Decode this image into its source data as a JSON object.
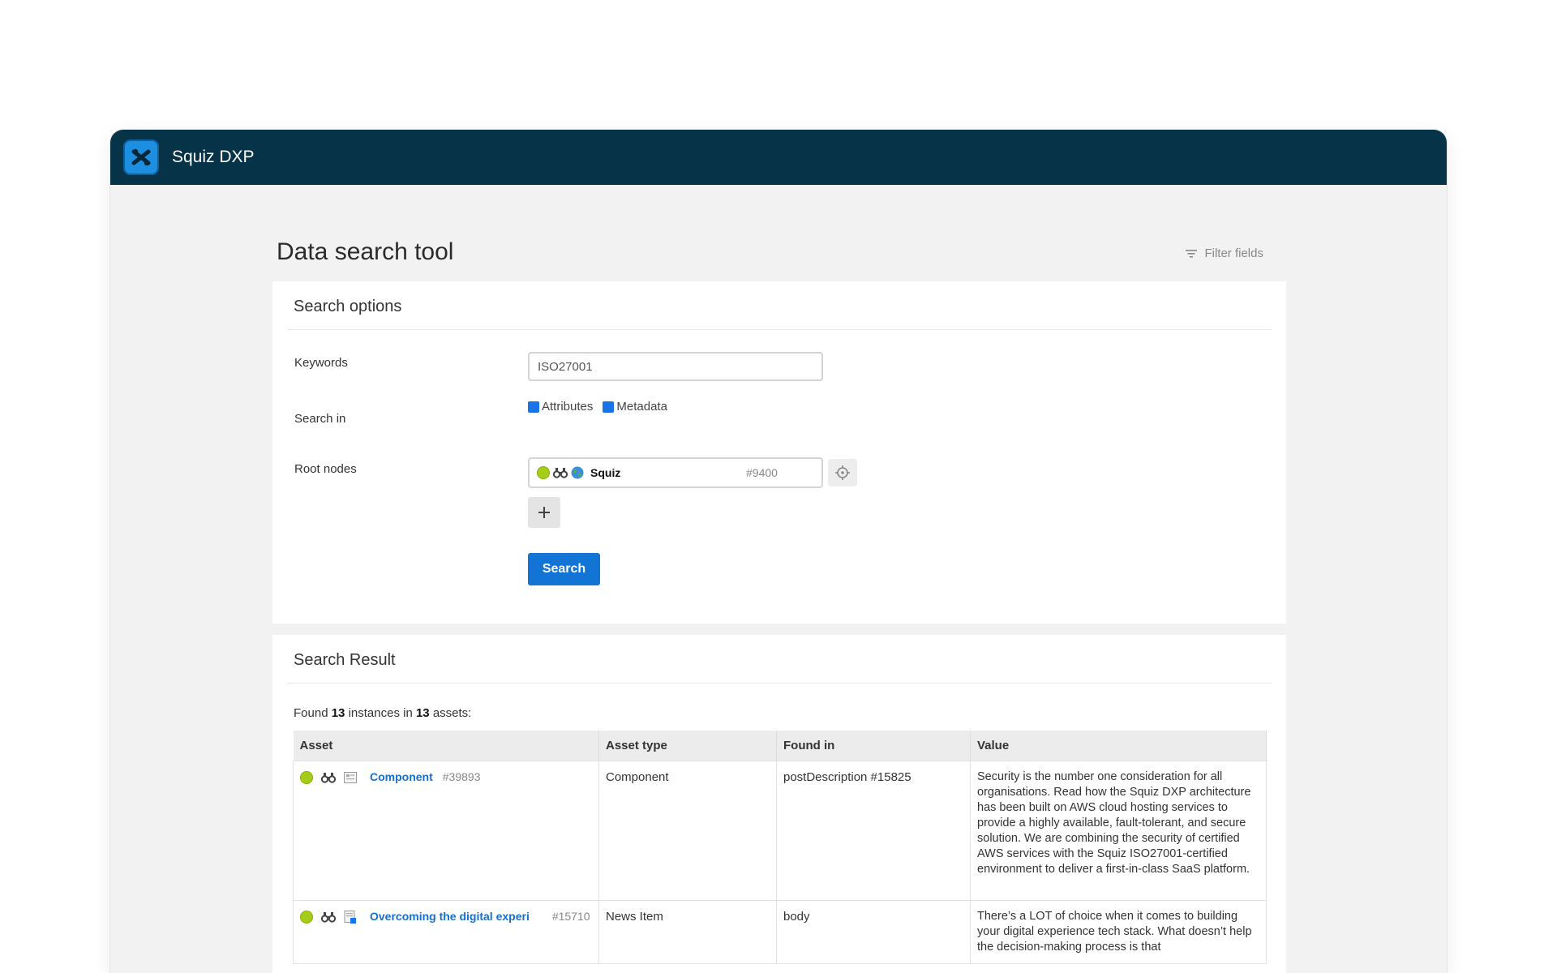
{
  "app": {
    "title": "Squiz DXP"
  },
  "page": {
    "title": "Data search tool",
    "filter_fields_label": "Filter fields"
  },
  "search_options": {
    "title": "Search options",
    "keywords_label": "Keywords",
    "keywords_value": "ISO27001",
    "search_in_label": "Search in",
    "search_in_options": [
      {
        "label": "Attributes",
        "checked": true
      },
      {
        "label": "Metadata",
        "checked": true
      }
    ],
    "root_nodes_label": "Root nodes",
    "root_node": {
      "name": "Squiz",
      "id": "#9400"
    },
    "search_button": "Search"
  },
  "results": {
    "title": "Search Result",
    "found_prefix": "Found",
    "instances_count": "13",
    "instances_mid": "instances in",
    "assets_count": "13",
    "assets_suffix": "assets:",
    "columns": [
      "Asset",
      "Asset type",
      "Found in",
      "Value"
    ],
    "rows": [
      {
        "asset_name": "Component",
        "asset_id": "#39893",
        "asset_type": "Component",
        "found_in": "postDescription #15825",
        "value": "Security is the number one consideration for all organisations. Read how the Squiz DXP architecture has been built on AWS cloud hosting services to provide a highly available, fault-tolerant, and secure solution. We are combining the security of certified AWS services with the Squiz ISO27001-certified environment to deliver a first-in-class SaaS platform."
      },
      {
        "asset_name": "Overcoming the digital experi",
        "asset_id": "#15710",
        "asset_type": "News Item",
        "found_in": "body",
        "value": "There’s a LOT of choice when it comes to building your digital experience tech stack. What doesn’t help the decision-making process is that"
      }
    ]
  },
  "colors": {
    "topbar": "#073349",
    "accent": "#1274d5",
    "status_live": "#a6cc1a"
  }
}
